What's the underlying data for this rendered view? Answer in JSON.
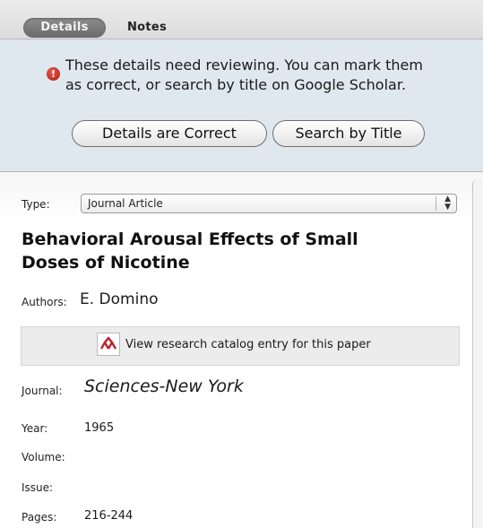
{
  "tabs": {
    "details_label": "Details",
    "notes_label": "Notes"
  },
  "notice": {
    "icon": "warning-icon",
    "message_line1": "These details need reviewing. You can mark them",
    "message_line2": "as correct, or search by title on Google Scholar.",
    "correct_button": "Details are Correct",
    "search_button": "Search by Title"
  },
  "details": {
    "type_label": "Type:",
    "type_value": "Journal Article",
    "title_line1": "Behavioral Arousal Effects of Small",
    "title_line2": "Doses of Nicotine",
    "authors_label": "Authors:",
    "authors_value": "E. Domino",
    "catalog_link": "View research catalog entry for this paper",
    "journal_label": "Journal:",
    "journal_value": "Sciences-New York",
    "year_label": "Year:",
    "year_value": "1965",
    "volume_label": "Volume:",
    "issue_label": "Issue:",
    "pages_label": "Pages:",
    "pages_value": "216-244"
  },
  "colors": {
    "notice_background": "#dfe7ef",
    "active_tab": "#7a7a7a",
    "catalog_icon": "#b8242a"
  }
}
